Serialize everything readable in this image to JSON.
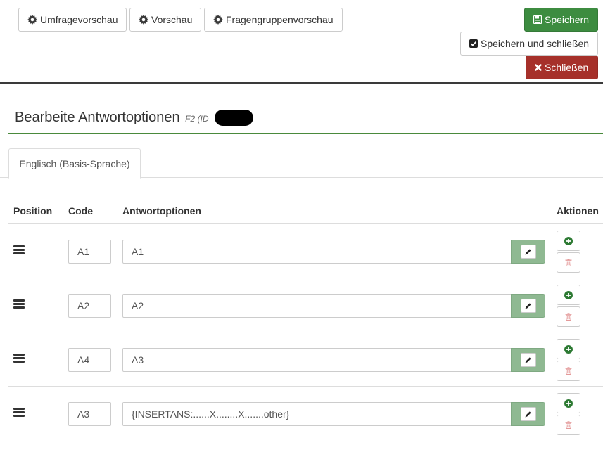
{
  "toolbar": {
    "survey_preview": "Umfragevorschau",
    "preview": "Vorschau",
    "group_preview": "Fragengruppenvorschau",
    "save": "Speichern",
    "save_close": "Speichern und schließen",
    "close": "Schließen"
  },
  "page": {
    "title": "Bearbeite Antwortoptionen",
    "subtitle": "F2 (ID"
  },
  "tabs": [
    {
      "label": "Englisch (Basis-Sprache)",
      "active": true
    }
  ],
  "table": {
    "headers": {
      "position": "Position",
      "code": "Code",
      "answer": "Antwortoptionen",
      "actions": "Aktionen"
    },
    "rows": [
      {
        "code": "A1",
        "answer": "A1"
      },
      {
        "code": "A2",
        "answer": "A2"
      },
      {
        "code": "A4",
        "answer": "A3"
      },
      {
        "code": "A3",
        "answer": "{INSERTANS:......X........X.......other}"
      }
    ]
  },
  "colors": {
    "accent_green": "#3d8c40",
    "danger_red": "#a6302a",
    "delete_icon": "#e49a9a"
  }
}
